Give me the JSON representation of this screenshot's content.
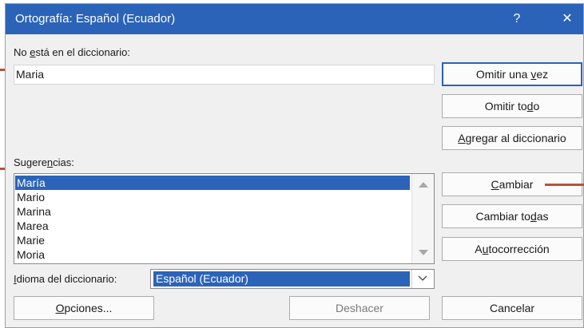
{
  "window": {
    "title": "Ortografía: Español (Ecuador)",
    "help_label": "?",
    "close_label": "✕"
  },
  "not_in_dictionary": {
    "label_pre": "No ",
    "label_accel": "e",
    "label_post": "stá en el diccionario:",
    "value": "Maria"
  },
  "suggestions": {
    "label_pre": "Sugere",
    "label_accel": "n",
    "label_post": "cias:",
    "items": [
      "María",
      "Mario",
      "Marina",
      "Marea",
      "Marie",
      "Moria"
    ],
    "selected_index": 0
  },
  "dictionary_language": {
    "label_pre": "",
    "label_accel": "I",
    "label_post": "dioma del diccionario:",
    "value": "Español (Ecuador)"
  },
  "buttons": {
    "ignore_once": {
      "pre": "Omitir una ",
      "accel": "v",
      "post": "ez"
    },
    "ignore_all": {
      "pre": "Omitir to",
      "accel": "d",
      "post": "o"
    },
    "add_to_dictionary": {
      "pre": "",
      "accel": "A",
      "post": "gregar al diccionario"
    },
    "change": {
      "pre": "",
      "accel": "C",
      "post": "ambiar"
    },
    "change_all": {
      "pre": "Cambiar to",
      "accel": "d",
      "post": "as"
    },
    "autocorrect": {
      "pre": "A",
      "accel": "u",
      "post": "tocorrección"
    },
    "options": {
      "pre": "",
      "accel": "O",
      "post": "pciones..."
    },
    "undo": {
      "pre": "Deshacer",
      "accel": "",
      "post": ""
    },
    "cancel": {
      "pre": "Cancelar",
      "accel": "",
      "post": ""
    }
  },
  "colors": {
    "accent": "#2b63b8",
    "callout": "#b5533a"
  }
}
